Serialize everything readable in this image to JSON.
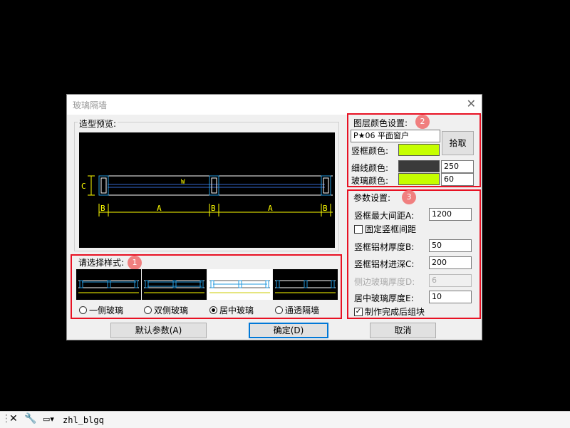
{
  "dialog": {
    "title": "玻璃隔墙",
    "close_icon": "close-icon"
  },
  "preview": {
    "label": "造型预览:",
    "dims": {
      "c": "C",
      "b": "B",
      "a": "A",
      "w": "W"
    }
  },
  "style_section": {
    "label": "请选择样式:",
    "badge": "1",
    "options": [
      {
        "label": "一侧玻璃",
        "selected": false
      },
      {
        "label": "双侧玻璃",
        "selected": false
      },
      {
        "label": "居中玻璃",
        "selected": true
      },
      {
        "label": "通透隔墙",
        "selected": false
      }
    ]
  },
  "layer_section": {
    "label": "图层颜色设置:",
    "badge": "2",
    "layer_value": "P★06 平面窗户",
    "pick_button": "拾取",
    "frame_color_label": "竖框颜色:",
    "frame_color": "#c6ff00",
    "line_color_label": "细线颜色:",
    "line_color": "#3a3a3a",
    "line_color_value": "250",
    "glass_color_label": "玻璃颜色:",
    "glass_color": "#c6ff00",
    "glass_color_value": "60"
  },
  "param_section": {
    "label": "参数设置:",
    "badge": "3",
    "max_spacing_label": "竖框最大间距A:",
    "max_spacing_value": "1200",
    "fixed_spacing_label": "固定竖框间距",
    "fixed_spacing_checked": false,
    "thickness_label": "竖框铝材厚度B:",
    "thickness_value": "50",
    "depth_label": "竖框铝材进深C:",
    "depth_value": "200",
    "side_glass_label": "侧边玻璃厚度D:",
    "side_glass_value": "6",
    "center_glass_label": "居中玻璃厚度E:",
    "center_glass_value": "10",
    "group_label": "制作完成后组块",
    "group_checked": true
  },
  "buttons": {
    "default_params": "默认参数(A)",
    "ok": "确定(D)",
    "cancel": "取消"
  },
  "statusbar": {
    "command": "zhl_blgq"
  }
}
